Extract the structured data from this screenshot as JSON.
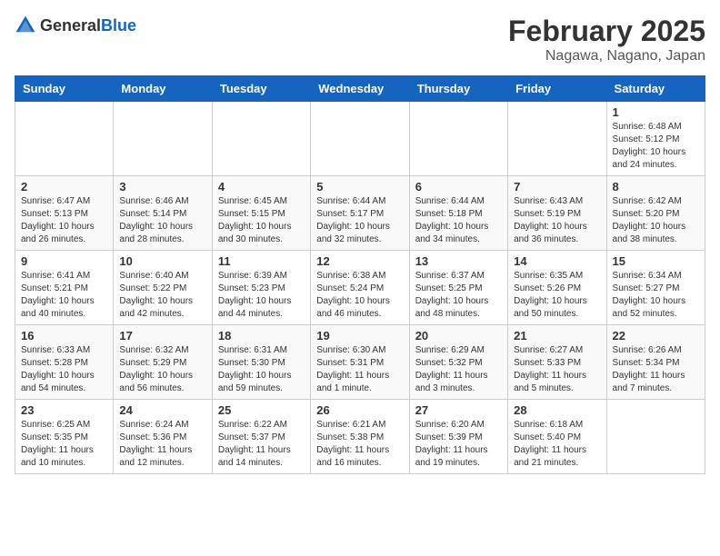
{
  "header": {
    "logo_general": "General",
    "logo_blue": "Blue",
    "month": "February 2025",
    "location": "Nagawa, Nagano, Japan"
  },
  "weekdays": [
    "Sunday",
    "Monday",
    "Tuesday",
    "Wednesday",
    "Thursday",
    "Friday",
    "Saturday"
  ],
  "weeks": [
    [
      {
        "day": "",
        "info": ""
      },
      {
        "day": "",
        "info": ""
      },
      {
        "day": "",
        "info": ""
      },
      {
        "day": "",
        "info": ""
      },
      {
        "day": "",
        "info": ""
      },
      {
        "day": "",
        "info": ""
      },
      {
        "day": "1",
        "info": "Sunrise: 6:48 AM\nSunset: 5:12 PM\nDaylight: 10 hours and 24 minutes."
      }
    ],
    [
      {
        "day": "2",
        "info": "Sunrise: 6:47 AM\nSunset: 5:13 PM\nDaylight: 10 hours and 26 minutes."
      },
      {
        "day": "3",
        "info": "Sunrise: 6:46 AM\nSunset: 5:14 PM\nDaylight: 10 hours and 28 minutes."
      },
      {
        "day": "4",
        "info": "Sunrise: 6:45 AM\nSunset: 5:15 PM\nDaylight: 10 hours and 30 minutes."
      },
      {
        "day": "5",
        "info": "Sunrise: 6:44 AM\nSunset: 5:17 PM\nDaylight: 10 hours and 32 minutes."
      },
      {
        "day": "6",
        "info": "Sunrise: 6:44 AM\nSunset: 5:18 PM\nDaylight: 10 hours and 34 minutes."
      },
      {
        "day": "7",
        "info": "Sunrise: 6:43 AM\nSunset: 5:19 PM\nDaylight: 10 hours and 36 minutes."
      },
      {
        "day": "8",
        "info": "Sunrise: 6:42 AM\nSunset: 5:20 PM\nDaylight: 10 hours and 38 minutes."
      }
    ],
    [
      {
        "day": "9",
        "info": "Sunrise: 6:41 AM\nSunset: 5:21 PM\nDaylight: 10 hours and 40 minutes."
      },
      {
        "day": "10",
        "info": "Sunrise: 6:40 AM\nSunset: 5:22 PM\nDaylight: 10 hours and 42 minutes."
      },
      {
        "day": "11",
        "info": "Sunrise: 6:39 AM\nSunset: 5:23 PM\nDaylight: 10 hours and 44 minutes."
      },
      {
        "day": "12",
        "info": "Sunrise: 6:38 AM\nSunset: 5:24 PM\nDaylight: 10 hours and 46 minutes."
      },
      {
        "day": "13",
        "info": "Sunrise: 6:37 AM\nSunset: 5:25 PM\nDaylight: 10 hours and 48 minutes."
      },
      {
        "day": "14",
        "info": "Sunrise: 6:35 AM\nSunset: 5:26 PM\nDaylight: 10 hours and 50 minutes."
      },
      {
        "day": "15",
        "info": "Sunrise: 6:34 AM\nSunset: 5:27 PM\nDaylight: 10 hours and 52 minutes."
      }
    ],
    [
      {
        "day": "16",
        "info": "Sunrise: 6:33 AM\nSunset: 5:28 PM\nDaylight: 10 hours and 54 minutes."
      },
      {
        "day": "17",
        "info": "Sunrise: 6:32 AM\nSunset: 5:29 PM\nDaylight: 10 hours and 56 minutes."
      },
      {
        "day": "18",
        "info": "Sunrise: 6:31 AM\nSunset: 5:30 PM\nDaylight: 10 hours and 59 minutes."
      },
      {
        "day": "19",
        "info": "Sunrise: 6:30 AM\nSunset: 5:31 PM\nDaylight: 11 hours and 1 minute."
      },
      {
        "day": "20",
        "info": "Sunrise: 6:29 AM\nSunset: 5:32 PM\nDaylight: 11 hours and 3 minutes."
      },
      {
        "day": "21",
        "info": "Sunrise: 6:27 AM\nSunset: 5:33 PM\nDaylight: 11 hours and 5 minutes."
      },
      {
        "day": "22",
        "info": "Sunrise: 6:26 AM\nSunset: 5:34 PM\nDaylight: 11 hours and 7 minutes."
      }
    ],
    [
      {
        "day": "23",
        "info": "Sunrise: 6:25 AM\nSunset: 5:35 PM\nDaylight: 11 hours and 10 minutes."
      },
      {
        "day": "24",
        "info": "Sunrise: 6:24 AM\nSunset: 5:36 PM\nDaylight: 11 hours and 12 minutes."
      },
      {
        "day": "25",
        "info": "Sunrise: 6:22 AM\nSunset: 5:37 PM\nDaylight: 11 hours and 14 minutes."
      },
      {
        "day": "26",
        "info": "Sunrise: 6:21 AM\nSunset: 5:38 PM\nDaylight: 11 hours and 16 minutes."
      },
      {
        "day": "27",
        "info": "Sunrise: 6:20 AM\nSunset: 5:39 PM\nDaylight: 11 hours and 19 minutes."
      },
      {
        "day": "28",
        "info": "Sunrise: 6:18 AM\nSunset: 5:40 PM\nDaylight: 11 hours and 21 minutes."
      },
      {
        "day": "",
        "info": ""
      }
    ]
  ]
}
